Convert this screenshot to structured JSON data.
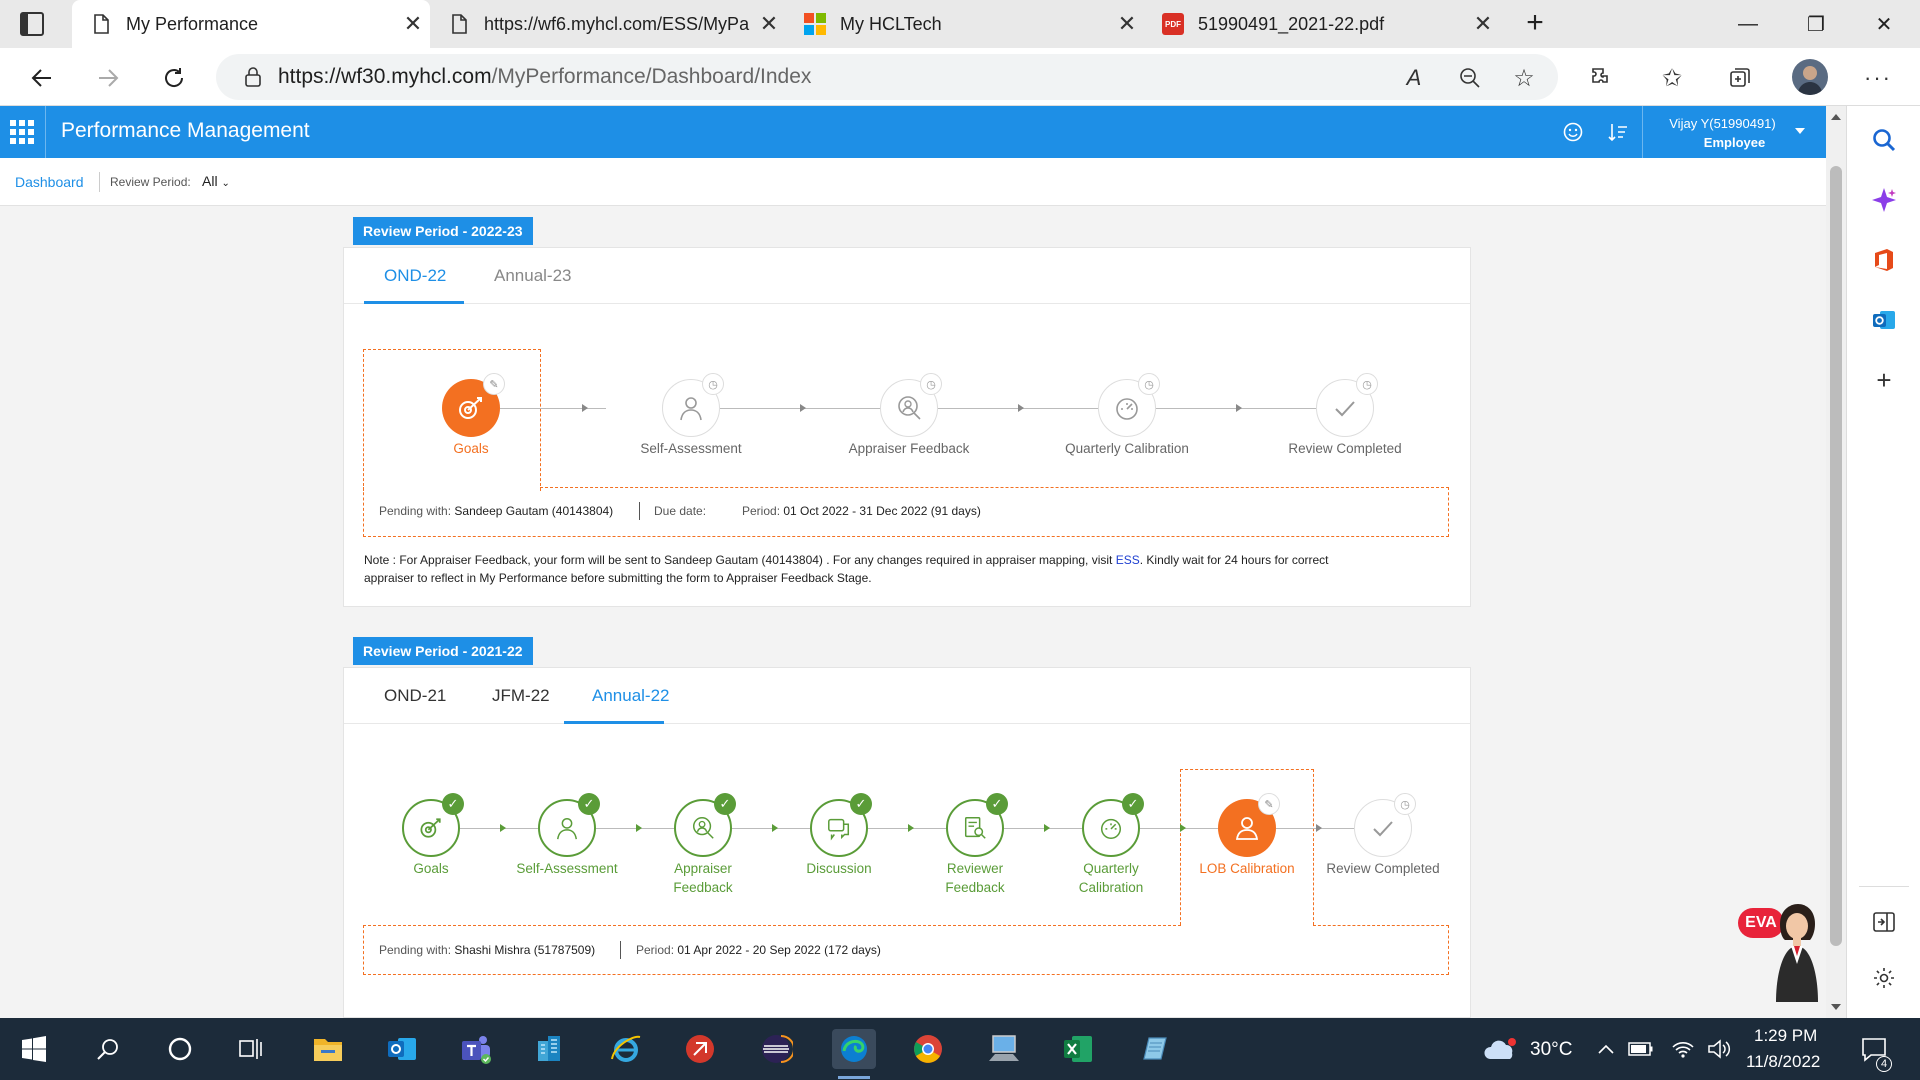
{
  "browser": {
    "tabs": [
      {
        "title": "My Performance",
        "active": true
      },
      {
        "title": "https://wf6.myhcl.com/ESS/MyPa",
        "active": false
      },
      {
        "title": "My HCLTech",
        "active": false
      },
      {
        "title": "51990491_2021-22.pdf",
        "active": false
      }
    ],
    "close_glyph": "✕",
    "new_tab_glyph": "+",
    "url_host": "https://wf30.myhcl.com",
    "url_path": "/MyPerformance/Dashboard/Index",
    "read_aloud_label": "A",
    "window_controls": {
      "minimize": "—",
      "restore": "❐",
      "close": "✕"
    }
  },
  "app": {
    "title": "Performance Management",
    "user_name": "Vijay Y(51990491)",
    "user_role": "Employee",
    "accent": "#1e8fe6"
  },
  "subbar": {
    "dashboard_link": "Dashboard",
    "review_period_label": "Review Period:",
    "review_period_value": "All"
  },
  "period1": {
    "label": "Review Period - 2022-23",
    "tabs": [
      "OND-22",
      "Annual-23"
    ],
    "active_tab": "OND-22",
    "steps": [
      {
        "name": "Goals",
        "state": "current",
        "icon": "goals-icon"
      },
      {
        "name": "Self-Assessment",
        "state": "pending",
        "icon": "person-icon"
      },
      {
        "name": "Appraiser Feedback",
        "state": "pending",
        "icon": "appraiser-icon"
      },
      {
        "name": "Quarterly Calibration",
        "state": "pending",
        "icon": "gauge-icon"
      },
      {
        "name": "Review Completed",
        "state": "pending",
        "icon": "check-icon"
      }
    ],
    "pending_label": "Pending with:",
    "pending_value": "Sandeep Gautam (40143804)",
    "due_label": "Due date:",
    "period_label": "Period:",
    "period_value": "01 Oct 2022 - 31 Dec 2022 (91 days)",
    "note_prefix": "Note : For Appraiser Feedback, your form will be sent to Sandeep Gautam (40143804) . For any changes required in appraiser mapping, visit ",
    "note_link": "ESS",
    "note_suffix": ". Kindly wait for 24 hours for correct",
    "note_line2": "appraiser to reflect in My Performance before submitting the form to Appraiser Feedback Stage."
  },
  "period2": {
    "label": "Review Period - 2021-22",
    "tabs": [
      "OND-21",
      "JFM-22",
      "Annual-22"
    ],
    "active_tab": "Annual-22",
    "steps": [
      {
        "name": "Goals",
        "state": "done"
      },
      {
        "name": "Self-Assessment",
        "state": "done"
      },
      {
        "name": "Appraiser Feedback",
        "state": "done"
      },
      {
        "name": "Discussion",
        "state": "done"
      },
      {
        "name": "Reviewer Feedback",
        "state": "done"
      },
      {
        "name": "Quarterly Calibration",
        "state": "done"
      },
      {
        "name": "LOB Calibration",
        "state": "current"
      },
      {
        "name": "Review Completed",
        "state": "pending"
      }
    ],
    "pending_label": "Pending with:",
    "pending_value": "Shashi Mishra (51787509)",
    "period_label": "Period:",
    "period_value": "01 Apr 2022 - 20 Sep 2022 (172 days)"
  },
  "eva": {
    "label": "EVA"
  },
  "taskbar": {
    "temperature": "30°C",
    "time": "1:29 PM",
    "date": "11/8/2022",
    "notification_count": "4"
  },
  "colors": {
    "orange": "#f37021",
    "green": "#5a9c38",
    "blue": "#1e8fe6"
  }
}
